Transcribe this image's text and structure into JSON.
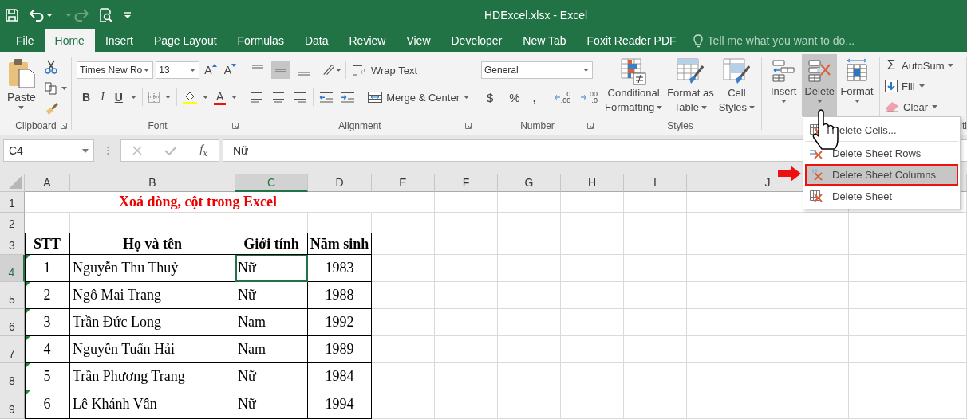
{
  "quick_access": [
    {
      "kind": "save",
      "disabled": false
    },
    {
      "kind": "undo",
      "disabled": false
    },
    {
      "kind": "redo",
      "disabled": true
    },
    {
      "kind": "print_preview",
      "disabled": false
    },
    {
      "kind": "customize",
      "disabled": false
    }
  ],
  "window": {
    "title": "HDExcel.xlsx - Excel"
  },
  "tabs": [
    {
      "label": "File",
      "selected": false
    },
    {
      "label": "Home",
      "selected": true
    },
    {
      "label": "Insert",
      "selected": false
    },
    {
      "label": "Page Layout",
      "selected": false
    },
    {
      "label": "Formulas",
      "selected": false
    },
    {
      "label": "Data",
      "selected": false
    },
    {
      "label": "Review",
      "selected": false
    },
    {
      "label": "View",
      "selected": false
    },
    {
      "label": "Developer",
      "selected": false
    },
    {
      "label": "New Tab",
      "selected": false
    },
    {
      "label": "Foxit Reader PDF",
      "selected": false
    }
  ],
  "tell_me": {
    "placeholder": "Tell me what you want to do..."
  },
  "ribbon": {
    "clipboard": {
      "label": "Clipboard",
      "paste": "Paste"
    },
    "font": {
      "label": "Font",
      "font_name": "Times New Ro",
      "font_size": "13",
      "grow": "A",
      "shrink": "A",
      "bold": "B",
      "italic": "I",
      "underline": "U",
      "font_color": "A"
    },
    "alignment": {
      "label": "Alignment",
      "wrap_text": "Wrap Text",
      "merge": "Merge & Center",
      "buttons": [
        {
          "kind": "top",
          "selected": false
        },
        {
          "kind": "middle",
          "selected": true
        },
        {
          "kind": "bottom",
          "selected": false
        },
        {
          "kind": "orientation",
          "selected": false
        },
        {
          "kind": "left",
          "selected": false
        },
        {
          "kind": "center",
          "selected": false
        },
        {
          "kind": "right",
          "selected": false
        },
        {
          "kind": "outdent",
          "selected": false
        },
        {
          "kind": "indent",
          "selected": false
        }
      ]
    },
    "number": {
      "label": "Number",
      "format": "General",
      "currency": "$",
      "percent": "%",
      "comma": ",",
      "increase_decimal": [
        ".0",
        ".00"
      ],
      "decrease_decimal": [
        ".00",
        ".0"
      ]
    },
    "styles": {
      "label": "Styles",
      "buttons": [
        {
          "kind": "conditional",
          "lines": [
            "Conditional",
            "Formatting"
          ]
        },
        {
          "kind": "table",
          "lines": [
            "Format as",
            "Table"
          ]
        },
        {
          "kind": "cell_styles",
          "lines": [
            "Cell",
            "Styles"
          ]
        }
      ]
    },
    "cells": {
      "buttons": [
        {
          "kind": "insert",
          "label": "Insert",
          "selected": false
        },
        {
          "kind": "delete",
          "label": "Delete",
          "selected": true
        },
        {
          "kind": "format",
          "label": "Format",
          "selected": false
        }
      ]
    },
    "editing": {
      "label": "iti",
      "items": [
        {
          "kind": "autosum",
          "icon": "Σ",
          "label": "AutoSum"
        },
        {
          "kind": "fill",
          "label": "Fill"
        },
        {
          "kind": "clear",
          "label": "Clear"
        }
      ]
    }
  },
  "formula_bar": {
    "name_box": "C4",
    "function": "f$_{x}$",
    "value": "Nữ"
  },
  "sheet": {
    "columns": [
      {
        "label": "A",
        "selected": false
      },
      {
        "label": "B",
        "selected": false
      },
      {
        "label": "C",
        "selected": true
      },
      {
        "label": "D",
        "selected": false
      },
      {
        "label": "E",
        "selected": false
      },
      {
        "label": "F",
        "selected": false
      },
      {
        "label": "G",
        "selected": false
      },
      {
        "label": "H",
        "selected": false
      },
      {
        "label": "I",
        "selected": false
      },
      {
        "label": "J",
        "selected": false
      }
    ],
    "rows": [
      {
        "header": "1",
        "selected": false,
        "kind": "title",
        "text": "Xoá dòng, cột trong Excel"
      },
      {
        "header": "2",
        "selected": false,
        "kind": "blank"
      },
      {
        "header": "3",
        "selected": false,
        "kind": "heading",
        "cells": [
          {
            "text": "STT",
            "selected": false
          },
          {
            "text": "Họ và tên",
            "selected": false
          },
          {
            "text": "Giới tính",
            "selected": false
          },
          {
            "text": "Năm sinh",
            "selected": false
          }
        ]
      },
      {
        "header": "4",
        "selected": true,
        "kind": "data",
        "flag": true,
        "cells": [
          {
            "text": "1",
            "selected": false
          },
          {
            "text": "Nguyễn Thu Thuỷ",
            "selected": false
          },
          {
            "text": "Nữ",
            "selected": true
          },
          {
            "text": "1983",
            "selected": false
          }
        ]
      },
      {
        "header": "5",
        "selected": false,
        "kind": "data",
        "flag": true,
        "cells": [
          {
            "text": "2",
            "selected": false
          },
          {
            "text": "Ngô Mai Trang",
            "selected": false
          },
          {
            "text": "Nữ",
            "selected": false
          },
          {
            "text": "1988",
            "selected": false
          }
        ]
      },
      {
        "header": "6",
        "selected": false,
        "kind": "data",
        "flag": true,
        "cells": [
          {
            "text": "3",
            "selected": false
          },
          {
            "text": "Trần Đức Long",
            "selected": false
          },
          {
            "text": "Nam",
            "selected": false
          },
          {
            "text": "1992",
            "selected": false
          }
        ]
      },
      {
        "header": "7",
        "selected": false,
        "kind": "data",
        "flag": true,
        "cells": [
          {
            "text": "4",
            "selected": false
          },
          {
            "text": "Nguyễn Tuấn Hải",
            "selected": false
          },
          {
            "text": "Nam",
            "selected": false
          },
          {
            "text": "1989",
            "selected": false
          }
        ]
      },
      {
        "header": "8",
        "selected": false,
        "kind": "data",
        "flag": true,
        "cells": [
          {
            "text": "5",
            "selected": false
          },
          {
            "text": "Trần Phương Trang",
            "selected": false
          },
          {
            "text": "Nữ",
            "selected": false
          },
          {
            "text": "1984",
            "selected": false
          }
        ]
      },
      {
        "header": "9",
        "selected": false,
        "kind": "data",
        "flag": true,
        "cells": [
          {
            "text": "6",
            "selected": false
          },
          {
            "text": "Lê Khánh Vân",
            "selected": false
          },
          {
            "text": "Nữ",
            "selected": false
          },
          {
            "text": "1994",
            "selected": false
          }
        ]
      }
    ]
  },
  "menu": {
    "items": [
      {
        "kind": "cells",
        "label": "elete Cells...",
        "selected": false
      },
      {
        "kind": "rows",
        "label": "Delete Sheet Rows",
        "selected": false
      },
      {
        "kind": "columns",
        "label": "Delete Sheet Columns",
        "selected": true
      },
      {
        "kind": "sheet",
        "label": "Delete Sheet",
        "selected": false
      }
    ]
  }
}
